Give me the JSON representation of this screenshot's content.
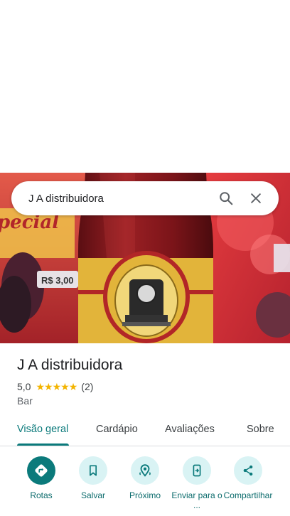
{
  "search": {
    "query": "J A distribuidora"
  },
  "photo": {
    "price_sign_text": "R$ 3,00",
    "sign_text": "pecial"
  },
  "place": {
    "name": "J A distribuidora",
    "rating": "5,0",
    "stars": 5,
    "review_count": "(2)",
    "category": "Bar"
  },
  "tabs": [
    {
      "label": "Visão geral",
      "active": true
    },
    {
      "label": "Cardápio",
      "active": false
    },
    {
      "label": "Avaliações",
      "active": false
    },
    {
      "label": "Sobre",
      "active": false
    }
  ],
  "actions": [
    {
      "label": "Rotas",
      "icon": "directions-icon"
    },
    {
      "label": "Salvar",
      "icon": "bookmark-icon"
    },
    {
      "label": "Próximo",
      "icon": "nearby-icon"
    },
    {
      "label": "Enviar para o ...",
      "icon": "send-to-phone-icon"
    },
    {
      "label": "Compartilhar",
      "icon": "share-icon"
    }
  ],
  "colors": {
    "accent": "#0b7a7b",
    "action_bg": "#d9f3f4",
    "star": "#f3b400"
  }
}
